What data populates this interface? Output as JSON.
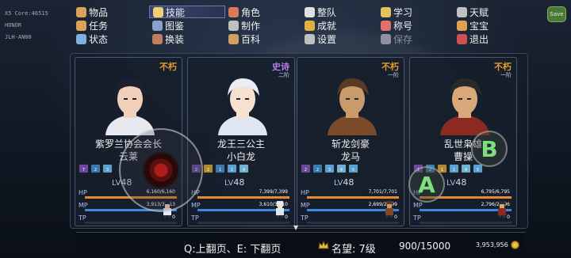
{
  "debug": [
    "X5 Core:46515",
    "HONOR",
    "JLH-AN00"
  ],
  "menu": [
    {
      "label": "物品",
      "icon": "bag-icon",
      "color": "#d9a35a"
    },
    {
      "label": "技能",
      "icon": "moon-icon",
      "color": "#f0d070",
      "active": true
    },
    {
      "label": "角色",
      "icon": "book-icon",
      "color": "#d97a5a"
    },
    {
      "label": "整队",
      "icon": "flag-icon",
      "color": "#e0e0e0"
    },
    {
      "label": "学习",
      "icon": "scroll-icon",
      "color": "#e7c060"
    },
    {
      "label": "天赋",
      "icon": "crown-icon",
      "color": "#c0c0c0"
    },
    {
      "label": "任务",
      "icon": "quest-icon",
      "color": "#d9a35a"
    },
    {
      "label": "图鉴",
      "icon": "atlas-icon",
      "color": "#8aa0c8"
    },
    {
      "label": "制作",
      "icon": "craft-icon",
      "color": "#c0c0c0"
    },
    {
      "label": "成就",
      "icon": "trophy-icon",
      "color": "#e0b040"
    },
    {
      "label": "称号",
      "icon": "rank-icon",
      "color": "#e07070"
    },
    {
      "label": "宝宝",
      "icon": "pet-icon",
      "color": "#e0a050"
    },
    {
      "label": "状态",
      "icon": "status-icon",
      "color": "#80b0e0"
    },
    {
      "label": "换装",
      "icon": "swap-icon",
      "color": "#c08060"
    },
    {
      "label": "百科",
      "icon": "wiki-icon",
      "color": "#d0a060"
    },
    {
      "label": "设置",
      "icon": "settings-icon",
      "color": "#c0c0c0"
    },
    {
      "label": "保存",
      "icon": "save-icon",
      "color": "#9090a0",
      "disabled": true
    },
    {
      "label": "退出",
      "icon": "exit-icon",
      "color": "#d05050"
    }
  ],
  "gear_label": "Save",
  "cards": [
    {
      "rarity": "不朽",
      "rarity_color": "#e69a2e",
      "stage": "",
      "title": "紫罗兰协会会长",
      "name": "云莱",
      "level_prefix": "LV",
      "level": "48",
      "hp_label": "HP",
      "hp": "6,160/6,160",
      "hp_ratio": 1.0,
      "mp_label": "MP",
      "mp": "3,913/3,913",
      "mp_ratio": 1.0,
      "tp_label": "TP",
      "tp": "0",
      "tp_ratio": 0.0,
      "states": [
        {
          "text": "7",
          "color": "#6a4aa0"
        },
        {
          "text": "2",
          "color": "#3a7ab0"
        },
        {
          "text": "3",
          "color": "#5aa0d0"
        }
      ]
    },
    {
      "rarity": "史诗",
      "rarity_color": "#b57ae6",
      "stage": "二阶",
      "title": "龙王三公主",
      "name": "小白龙",
      "level_prefix": "LV",
      "level": "48",
      "hp_label": "HP",
      "hp": "7,399/7,399",
      "hp_ratio": 1.0,
      "mp_label": "MP",
      "mp": "3,610/3,610",
      "mp_ratio": 1.0,
      "tp_label": "TP",
      "tp": "0",
      "tp_ratio": 0.0,
      "states": [
        {
          "text": "2",
          "color": "#6a4aa0"
        },
        {
          "text": "2",
          "color": "#b08a30"
        },
        {
          "text": "1",
          "color": "#3a7ab0"
        },
        {
          "text": "1",
          "color": "#5aa0d0"
        },
        {
          "text": "4",
          "color": "#70b0d0"
        }
      ]
    },
    {
      "rarity": "不朽",
      "rarity_color": "#e69a2e",
      "stage": "一阶",
      "title": "斩龙剑豪",
      "name": "龙马",
      "level_prefix": "LV",
      "level": "48",
      "hp_label": "HP",
      "hp": "7,701/7,701",
      "hp_ratio": 1.0,
      "mp_label": "MP",
      "mp": "2,699/2,699",
      "mp_ratio": 1.0,
      "tp_label": "TP",
      "tp": "0",
      "tp_ratio": 0.0,
      "states": [
        {
          "text": "2",
          "color": "#6a4aa0"
        },
        {
          "text": "2",
          "color": "#3a7ab0"
        },
        {
          "text": "3",
          "color": "#5aa0d0"
        },
        {
          "text": "4",
          "color": "#70b0d0"
        },
        {
          "text": "5",
          "color": "#5aa0d0"
        }
      ]
    },
    {
      "rarity": "不朽",
      "rarity_color": "#e69a2e",
      "stage": "一阶",
      "title": "乱世枭雄",
      "name": "曹操",
      "level_prefix": "LV",
      "level": "48",
      "hp_label": "HP",
      "hp": "6,795/6,795",
      "hp_ratio": 1.0,
      "mp_label": "MP",
      "mp": "2,796/2,796",
      "mp_ratio": 1.0,
      "tp_label": "TP",
      "tp": "0",
      "tp_ratio": 0.0,
      "states": [
        {
          "text": "1",
          "color": "#6a4aa0"
        },
        {
          "text": "2",
          "color": "#3a7ab0"
        },
        {
          "text": "1",
          "color": "#b08a30"
        },
        {
          "text": "1",
          "color": "#5aa0d0"
        },
        {
          "text": "4",
          "color": "#70b0d0"
        },
        {
          "text": "5",
          "color": "#5aa0d0"
        }
      ]
    }
  ],
  "colors": {
    "hp": "#e58a2e",
    "mp": "#3a8ae0",
    "tp": "#2a3040"
  },
  "controls": {
    "a_label": "A",
    "b_label": "B"
  },
  "bottom": {
    "nav_hint": "Q:上翻页、E: 下翻页",
    "reputation_label": "名望: 7级",
    "reputation_value": "900/15000",
    "gold": "3,953,956"
  }
}
